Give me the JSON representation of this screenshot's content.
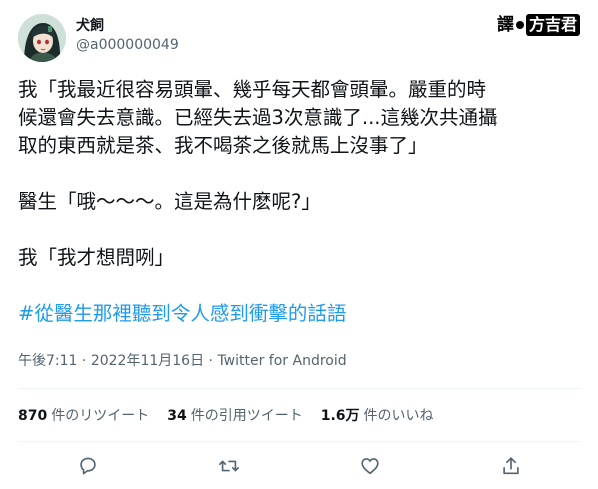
{
  "user": {
    "display_name": "犬飼",
    "handle": "@a000000049",
    "avatar_icon": "avatar-illustration"
  },
  "translator": {
    "tag": "譯",
    "name": "方吉君"
  },
  "tweet": {
    "line1": "我「我最近很容易頭暈、幾乎每天都會頭暈。嚴重的時",
    "line2": "候還會失去意識。已經失去過3次意識了...這幾次共通攝",
    "line3": "取的東西就是茶、我不喝茶之後就馬上沒事了」",
    "line4": "醫生「哦～～～。這是為什麽呢?」",
    "line5": "我「我才想問咧」",
    "hashtag": "#從醫生那裡聽到令人感到衝擊的話語"
  },
  "meta": {
    "time": "午後7:11",
    "dot": " · ",
    "date": "2022年11月16日",
    "dot2": " · ",
    "source": "Twitter for Android"
  },
  "stats": {
    "retweets_count": "870",
    "retweets_label": "件のリツイート",
    "quotes_count": "34",
    "quotes_label": "件の引用ツイート",
    "likes_count": "1.6万",
    "likes_label": "件のいいね"
  },
  "actions": {
    "reply_icon": "reply-icon",
    "retweet_icon": "retweet-icon",
    "like_icon": "heart-icon",
    "share_icon": "share-icon"
  },
  "colors": {
    "link": "#1d9bf0",
    "secondary_text": "#536471",
    "primary_text": "#0f1419"
  }
}
